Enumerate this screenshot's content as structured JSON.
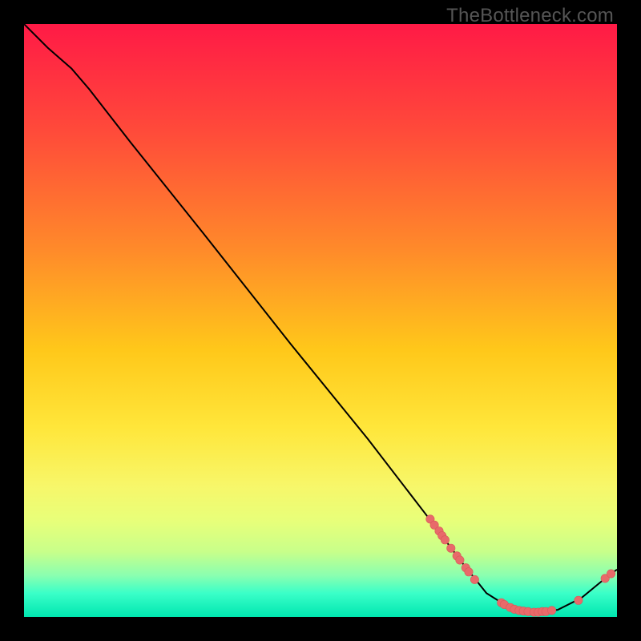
{
  "watermark": "TheBottleneck.com",
  "colors": {
    "curve_stroke": "#000000",
    "marker_fill": "#e86a6a",
    "marker_stroke": "#d85a5a"
  },
  "chart_data": {
    "type": "line",
    "title": "",
    "xlabel": "",
    "ylabel": "",
    "xlim": [
      0,
      100
    ],
    "ylim": [
      0,
      100
    ],
    "note": "Axes are unlabeled; x/y are normalized 0–100. y≈100 is top (worst/red), y≈0 is bottom (best/green).",
    "curve": [
      {
        "x": 0,
        "y": 100
      },
      {
        "x": 4,
        "y": 96
      },
      {
        "x": 8,
        "y": 92.5
      },
      {
        "x": 11,
        "y": 89
      },
      {
        "x": 18,
        "y": 80
      },
      {
        "x": 30,
        "y": 65
      },
      {
        "x": 45,
        "y": 46
      },
      {
        "x": 58,
        "y": 30
      },
      {
        "x": 68,
        "y": 17
      },
      {
        "x": 74,
        "y": 9
      },
      {
        "x": 78,
        "y": 4
      },
      {
        "x": 82,
        "y": 1.5
      },
      {
        "x": 86,
        "y": 0.8
      },
      {
        "x": 90,
        "y": 1.2
      },
      {
        "x": 94,
        "y": 3.2
      },
      {
        "x": 98,
        "y": 6.5
      },
      {
        "x": 100,
        "y": 8
      }
    ],
    "markers": [
      {
        "x": 68.5,
        "y": 16.5
      },
      {
        "x": 69.2,
        "y": 15.5
      },
      {
        "x": 70.0,
        "y": 14.5
      },
      {
        "x": 70.5,
        "y": 13.7
      },
      {
        "x": 71.0,
        "y": 13.0
      },
      {
        "x": 72.0,
        "y": 11.6
      },
      {
        "x": 73.0,
        "y": 10.3
      },
      {
        "x": 73.5,
        "y": 9.6
      },
      {
        "x": 74.5,
        "y": 8.3
      },
      {
        "x": 75.0,
        "y": 7.6
      },
      {
        "x": 76.0,
        "y": 6.3
      },
      {
        "x": 80.5,
        "y": 2.4
      },
      {
        "x": 81.0,
        "y": 2.1
      },
      {
        "x": 82.0,
        "y": 1.6
      },
      {
        "x": 82.7,
        "y": 1.3
      },
      {
        "x": 83.5,
        "y": 1.1
      },
      {
        "x": 84.2,
        "y": 1.0
      },
      {
        "x": 85.0,
        "y": 0.9
      },
      {
        "x": 86.0,
        "y": 0.8
      },
      {
        "x": 86.7,
        "y": 0.8
      },
      {
        "x": 87.4,
        "y": 0.9
      },
      {
        "x": 88.0,
        "y": 0.9
      },
      {
        "x": 89.0,
        "y": 1.1
      },
      {
        "x": 93.5,
        "y": 2.8
      },
      {
        "x": 98.0,
        "y": 6.5
      },
      {
        "x": 99.0,
        "y": 7.3
      }
    ]
  }
}
